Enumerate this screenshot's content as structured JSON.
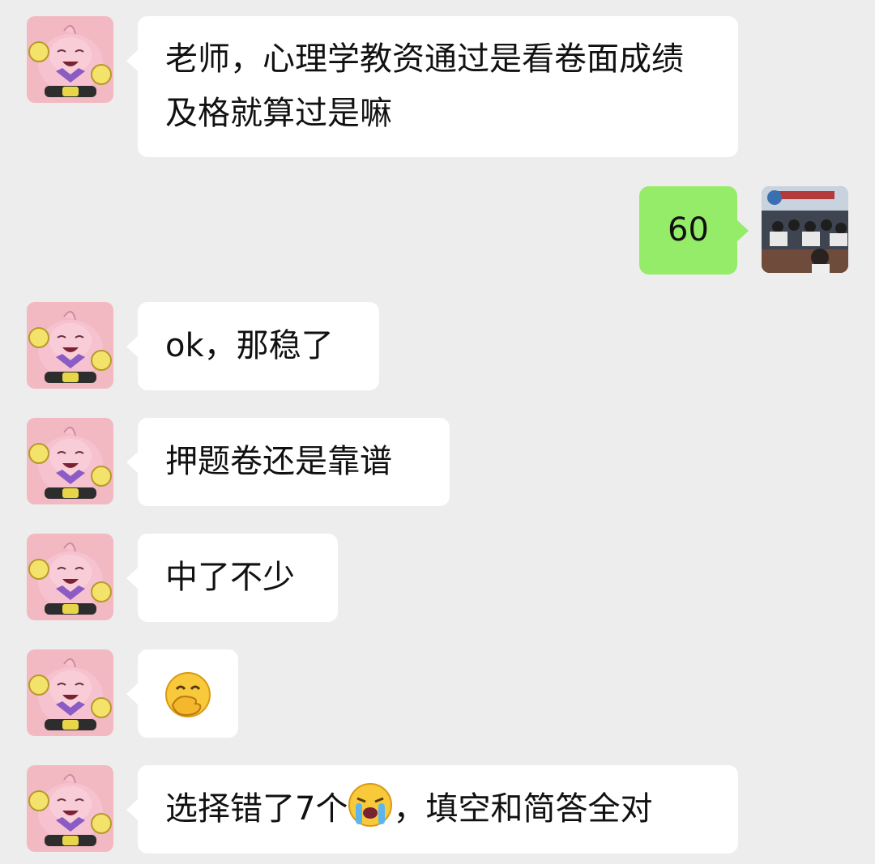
{
  "messages": [
    {
      "sender": "other",
      "text": "老师，心理学教资通过是看卷面成绩及格就算过是嘛"
    },
    {
      "sender": "me",
      "text": "60"
    },
    {
      "sender": "other",
      "text": "ok，那稳了"
    },
    {
      "sender": "other",
      "text": "押题卷还是靠谱"
    },
    {
      "sender": "other",
      "text": "中了不少"
    },
    {
      "sender": "other",
      "emoji": "face-with-hand-over-mouth-emoji"
    },
    {
      "sender": "other",
      "text_before": "选择错了7个",
      "emoji": "loudly-crying-face-emoji",
      "text_after": "，填空和简答全对"
    }
  ],
  "colors": {
    "background": "#ededed",
    "incoming_bubble": "#ffffff",
    "outgoing_bubble": "#95ec69",
    "text": "#111111"
  },
  "avatars": {
    "other": "cartoon-character-avatar",
    "me": "meeting-room-photo-avatar"
  }
}
